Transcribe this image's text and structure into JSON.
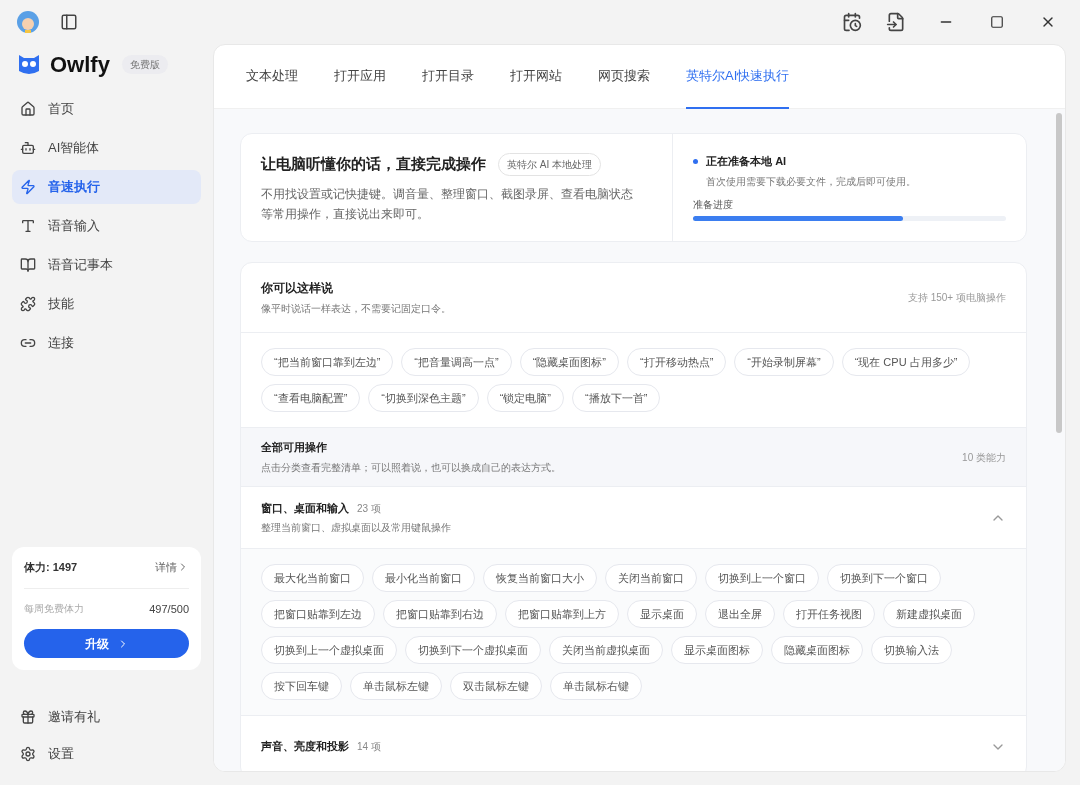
{
  "sidebar": {
    "brand": "Owlfy",
    "edition": "免费版",
    "items": [
      {
        "label": "首页",
        "selected": false
      },
      {
        "label": "AI智能体",
        "selected": false
      },
      {
        "label": "音速执行",
        "selected": true
      },
      {
        "label": "语音输入",
        "selected": false
      },
      {
        "label": "语音记事本",
        "selected": false
      },
      {
        "label": "技能",
        "selected": false
      },
      {
        "label": "连接",
        "selected": false
      }
    ],
    "energy": {
      "title": "体力: 1497",
      "details": "详情",
      "daily_label": "每周免费体力",
      "daily_value": "497/500",
      "upgrade": "升级"
    },
    "footer": [
      {
        "label": "邀请有礼"
      },
      {
        "label": "设置"
      }
    ]
  },
  "tabs": [
    {
      "label": "文本处理",
      "selected": false
    },
    {
      "label": "打开应用",
      "selected": false
    },
    {
      "label": "打开目录",
      "selected": false
    },
    {
      "label": "打开网站",
      "selected": false
    },
    {
      "label": "网页搜索",
      "selected": false
    },
    {
      "label": "英特尔AI快速执行",
      "selected": true
    }
  ],
  "hero": {
    "title": "让电脑听懂你的话，直接完成操作",
    "badge": "英特尔 AI 本地处理",
    "description": "不用找设置或记快捷键。调音量、整理窗口、截图录屏、查看电脑状态等常用操作，直接说出来即可。",
    "status": {
      "title": "正在准备本地 AI",
      "subtitle": "首次使用需要下载必要文件，完成后即可使用。",
      "progress_label": "准备进度",
      "level": 0.67
    }
  },
  "examples": {
    "title": "你可以这样说",
    "subtitle": "像平时说话一样表达，不需要记固定口令。",
    "count": "支持 150+ 项电脑操作",
    "phrases": [
      "“把当前窗口靠到左边”",
      "“把音量调高一点”",
      "“隐藏桌面图标”",
      "“打开移动热点”",
      "“开始录制屏幕”",
      "“现在 CPU 占用多少”",
      "“查看电脑配置”",
      "“切换到深色主题”",
      "“锁定电脑”",
      "“播放下一首”"
    ]
  },
  "all_actions": {
    "title": "全部可用操作",
    "subtitle": "点击分类查看完整清单；可以照着说，也可以换成自己的表达方式。",
    "count": "10 类能力"
  },
  "categories": [
    {
      "title": "窗口、桌面和输入",
      "count": "23 项",
      "subtitle": "整理当前窗口、虚拟桌面以及常用键鼠操作",
      "expanded": true,
      "actions": [
        "最大化当前窗口",
        "最小化当前窗口",
        "恢复当前窗口大小",
        "关闭当前窗口",
        "切换到上一个窗口",
        "切换到下一个窗口",
        "把窗口贴靠到左边",
        "把窗口贴靠到右边",
        "把窗口贴靠到上方",
        "显示桌面",
        "退出全屏",
        "打开任务视图",
        "新建虚拟桌面",
        "切换到上一个虚拟桌面",
        "切换到下一个虚拟桌面",
        "关闭当前虚拟桌面",
        "显示桌面图标",
        "隐藏桌面图标",
        "切换输入法",
        "按下回车键",
        "单击鼠标左键",
        "双击鼠标左键",
        "单击鼠标右键"
      ]
    },
    {
      "title": "声音、亮度和投影",
      "count": "14 项",
      "expanded": false
    }
  ]
}
